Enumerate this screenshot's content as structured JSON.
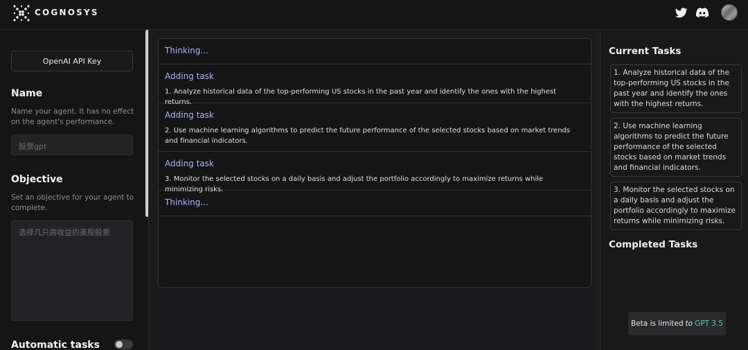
{
  "header": {
    "brand": "COGNOSYS",
    "icons": [
      "logo-icon",
      "twitter-icon",
      "discord-icon",
      "avatar"
    ]
  },
  "sidebar": {
    "api_key_button": "OpenAI API Key",
    "name": {
      "title": "Name",
      "description": "Name your agent. It has no effect on the agent's performance.",
      "value": "股票gpt"
    },
    "objective": {
      "title": "Objective",
      "description": "Set an objective for your agent to complete.",
      "value": "选择几只高收益的美股股票"
    },
    "automatic_tasks": {
      "label": "Automatic tasks",
      "enabled": false
    }
  },
  "log": [
    {
      "title": "Thinking...",
      "text": ""
    },
    {
      "title": "Adding task",
      "text": "1. Analyze historical data of the top-performing US stocks in the past year and identify the ones with the highest returns."
    },
    {
      "title": "Adding task",
      "text": "2. Use machine learning algorithms to predict the future performance of the selected stocks based on market trends and financial indicators."
    },
    {
      "title": "Adding task",
      "text": "3. Monitor the selected stocks on a daily basis and adjust the portfolio accordingly to maximize returns while minimizing risks."
    },
    {
      "title": "Thinking...",
      "text": ""
    }
  ],
  "current_tasks": {
    "title": "Current Tasks",
    "items": [
      "1. Analyze historical data of the top-performing US stocks in the past year and identify the ones with the highest returns.",
      "2. Use machine learning algorithms to predict the future performance of the selected stocks based on market trends and financial indicators.",
      "3. Monitor the selected stocks on a daily basis and adjust the portfolio accordingly to maximize returns while minimizing risks."
    ]
  },
  "completed_tasks": {
    "title": "Completed Tasks"
  },
  "beta": {
    "prefix": "Beta is limited",
    "to": "to",
    "model": "GPT 3.5"
  },
  "colors": {
    "accent_log_title": "#a9b4ff",
    "model_green": "#4fd1a5",
    "background": "#1b1b1d"
  }
}
